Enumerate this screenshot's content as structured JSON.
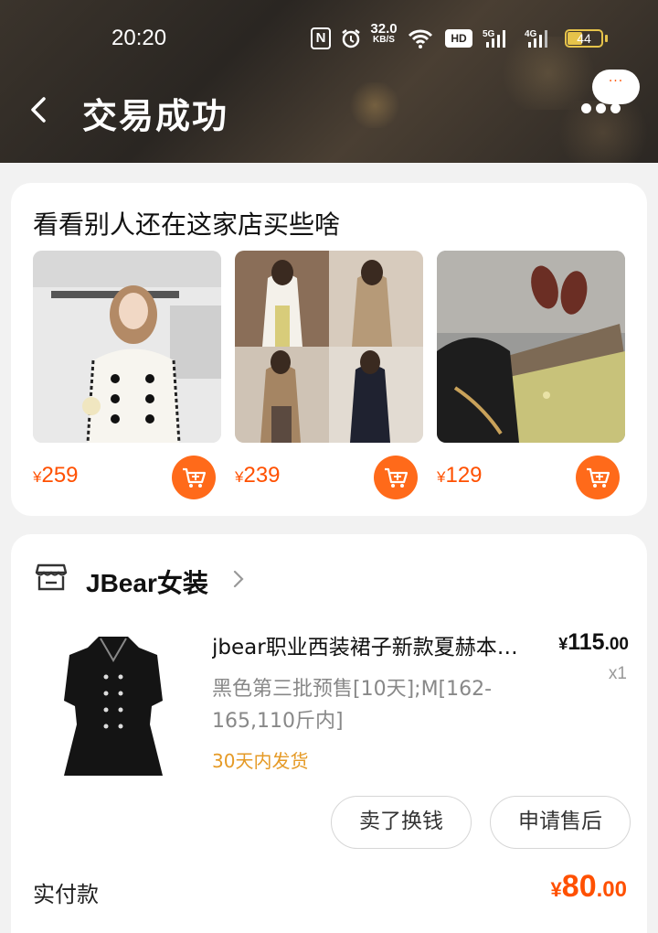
{
  "status_bar": {
    "time": "20:20",
    "speed_value": "32.0",
    "speed_unit": "KB/S",
    "hd_label": "HD",
    "signal1_label": "5G",
    "signal2_label": "4G",
    "battery": "44"
  },
  "header": {
    "title": "交易成功",
    "back_icon": "chevron-left-icon",
    "message_icon": "chat-bubble-icon",
    "more_icon": "more-dots-icon"
  },
  "recommendations": {
    "title": "看看别人还在这家店买些啥",
    "items": [
      {
        "currency": "¥",
        "price": "259"
      },
      {
        "currency": "¥",
        "price": "239"
      },
      {
        "currency": "¥",
        "price": "129"
      }
    ],
    "cart_icon": "add-to-cart-icon"
  },
  "order": {
    "store_name": "JBear女装",
    "item": {
      "title": "jbear职业西装裙子新款夏赫本风黑色连衣裙",
      "spec": "黑色第三批预售[10天];M[162-165,110斤内]",
      "shipping": "30天内发货",
      "price_currency": "¥",
      "price_int": "115",
      "price_dec": ".00",
      "quantity": "x1"
    },
    "actions": {
      "sell": "卖了换钱",
      "after_sale": "申请售后"
    },
    "paid": {
      "label": "实付款",
      "currency": "¥",
      "int": "80",
      "dec": ".00"
    }
  },
  "colors": {
    "accent": "#ff5000",
    "shipping": "#e59a26"
  }
}
